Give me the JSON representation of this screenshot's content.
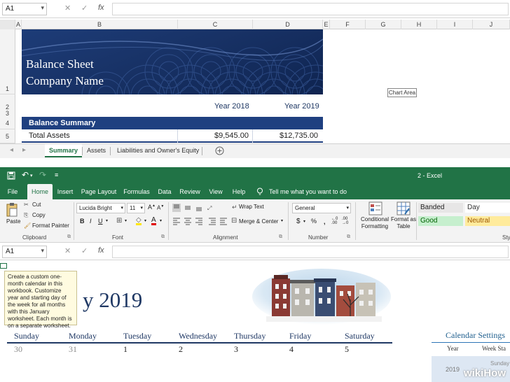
{
  "top": {
    "name_box": "A1",
    "columns": [
      "A",
      "B",
      "C",
      "D",
      "E",
      "F",
      "G",
      "H",
      "I",
      "J"
    ],
    "rows": [
      "1",
      "2",
      "3",
      "4",
      "5"
    ],
    "banner_title": "Balance Sheet",
    "banner_subtitle": "Company Name",
    "chart_area_tip": "Chart Area",
    "year_labels": [
      "Year 2018",
      "Year 2019"
    ],
    "summary_header": "Balance Summary",
    "asset_row": {
      "label": "Total Assets",
      "v2018": "$9,545.00",
      "v2019": "$12,735.00"
    },
    "sheet_tabs": [
      "Summary",
      "Assets",
      "Liabilities and Owner's Equity"
    ],
    "active_tab": "Summary"
  },
  "bottom": {
    "window_title": "2  -  Excel",
    "ribbon_tabs": [
      "File",
      "Home",
      "Insert",
      "Page Layout",
      "Formulas",
      "Data",
      "Review",
      "View",
      "Help"
    ],
    "active_ribbon_tab": "Home",
    "tell_me": "Tell me what you want to do",
    "clipboard": {
      "paste": "Paste",
      "cut": "Cut",
      "copy": "Copy",
      "format_painter": "Format Painter",
      "label": "Clipboard"
    },
    "font": {
      "name": "Lucida Bright",
      "size": "11",
      "label": "Font"
    },
    "alignment": {
      "wrap_text": "Wrap Text",
      "merge_center": "Merge & Center",
      "label": "Alignment"
    },
    "number": {
      "format": "General",
      "label": "Number"
    },
    "styles": {
      "conditional_formatting": "Conditional Formatting",
      "format_as_table": "Format as Table",
      "cells": [
        "Banded",
        "Day",
        "Good",
        "Neutral"
      ],
      "label": "Sty"
    },
    "name_box": "A1",
    "tooltip": "Create a custom one-month calendar in this workbook. Customize year and starting day of the week for all months with this January worksheet. Each month is on a separate worksheet.",
    "calendar_title": "y 2019",
    "days": [
      "Sunday",
      "Monday",
      "Tuesday",
      "Wednesday",
      "Thursday",
      "Friday",
      "Saturday"
    ],
    "day_numbers": [
      "30",
      "31",
      "1",
      "2",
      "3",
      "4",
      "5"
    ],
    "settings_title": "Calendar Settings",
    "settings_cols": [
      "Year",
      "Week Sta"
    ],
    "settings_year_value": "2019",
    "settings_week_value": "Sunday"
  },
  "watermark": {
    "part1": "wiki",
    "part2": "How"
  },
  "colors": {
    "excel_green": "#217346",
    "banner_navy": "#1d3c78",
    "summary_blue": "#1f4080",
    "calendar_navy": "#1f3864"
  }
}
